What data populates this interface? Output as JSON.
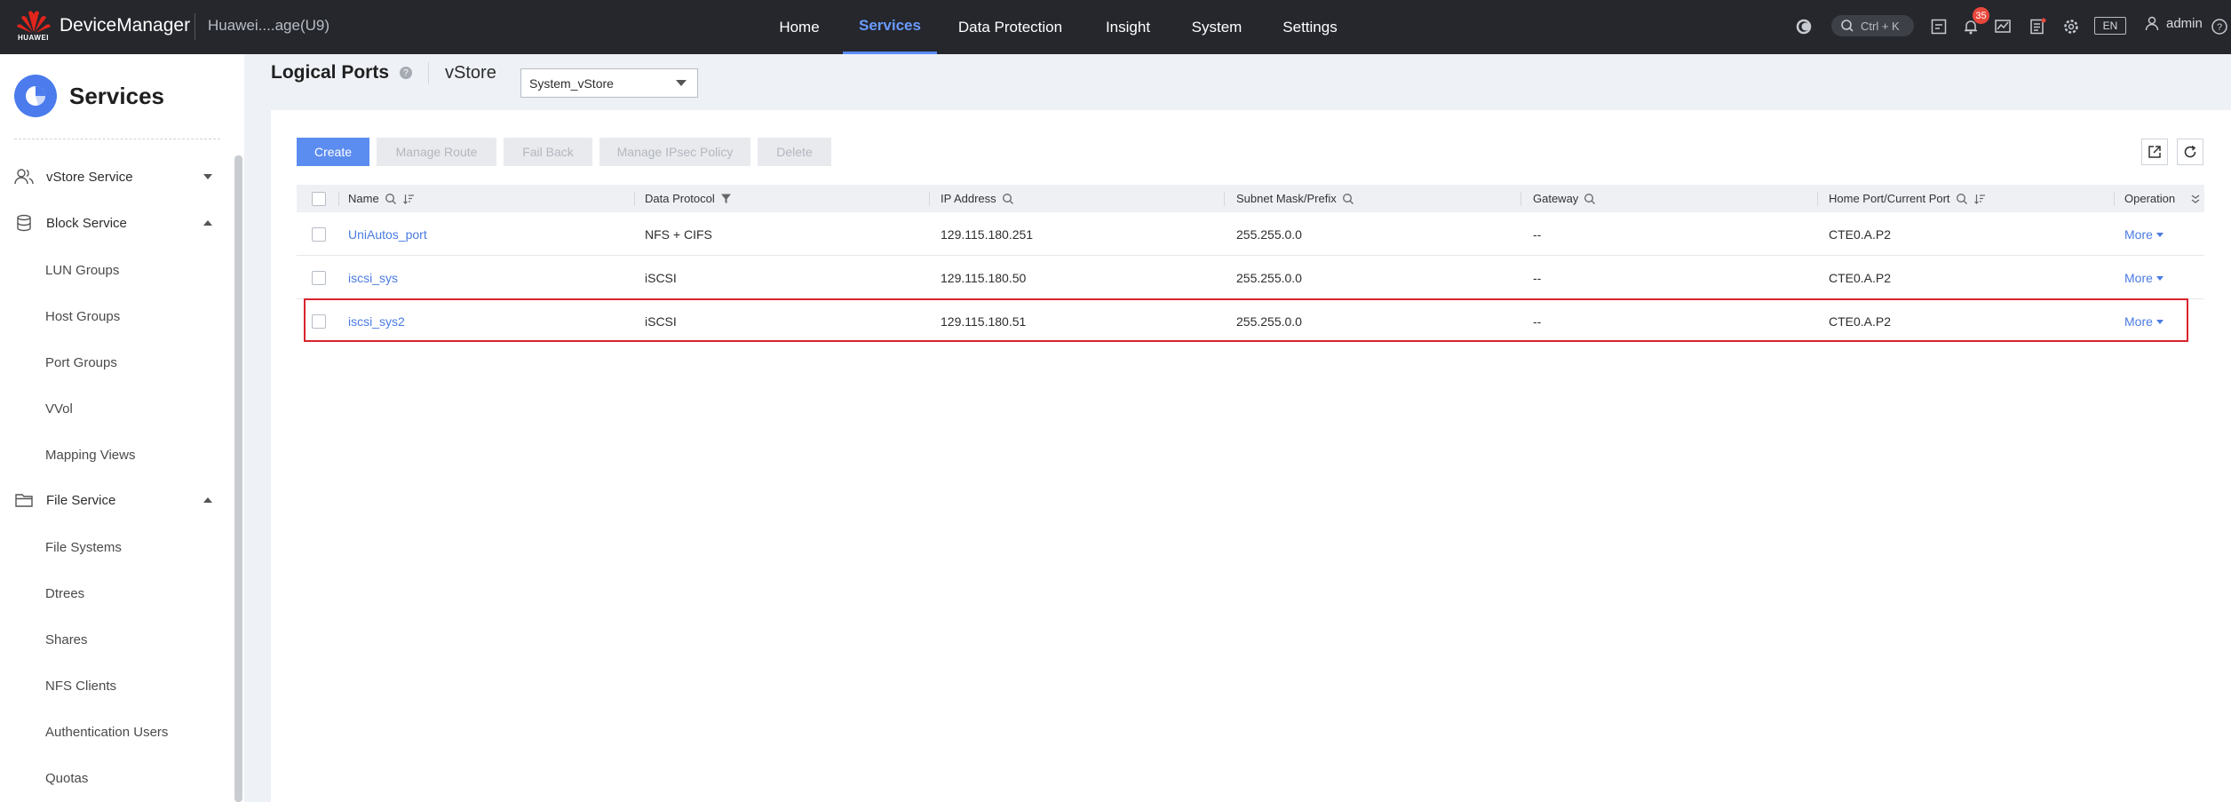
{
  "topbar": {
    "brand": "DeviceManager",
    "logo_text": "HUAWEI",
    "device_name": "Huawei....age(U9)",
    "nav": [
      "Home",
      "Services",
      "Data Protection",
      "Insight",
      "System",
      "Settings"
    ],
    "active_nav": "Services",
    "search_shortcut": "Ctrl + K",
    "alarm_count": "35",
    "language": "EN",
    "user": "admin"
  },
  "sidebar": {
    "title": "Services",
    "groups": {
      "vstore": "vStore Service",
      "block": "Block Service",
      "file": "File Service"
    },
    "block_items": [
      "LUN Groups",
      "Host Groups",
      "Port Groups",
      "VVol",
      "Mapping Views"
    ],
    "file_items": [
      "File Systems",
      "Dtrees",
      "Shares",
      "NFS Clients",
      "Authentication Users",
      "Quotas"
    ]
  },
  "page": {
    "title": "Logical Ports",
    "vstore_label": "vStore",
    "vstore_value": "System_vStore"
  },
  "toolbar": {
    "create": "Create",
    "manage_route": "Manage Route",
    "fail_back": "Fail Back",
    "manage_ipsec": "Manage IPsec Policy",
    "delete": "Delete"
  },
  "table": {
    "columns": [
      "Name",
      "Data Protocol",
      "IP Address",
      "Subnet Mask/Prefix",
      "Gateway",
      "Home Port/Current Port",
      "Operation"
    ],
    "rows": [
      {
        "name": "UniAutos_port",
        "protocol": "NFS + CIFS",
        "ip": "129.115.180.251",
        "mask": "255.255.0.0",
        "gateway": "--",
        "port": "CTE0.A.P2",
        "op": "More"
      },
      {
        "name": "iscsi_sys",
        "protocol": "iSCSI",
        "ip": "129.115.180.50",
        "mask": "255.255.0.0",
        "gateway": "--",
        "port": "CTE0.A.P2",
        "op": "More"
      },
      {
        "name": "iscsi_sys2",
        "protocol": "iSCSI",
        "ip": "129.115.180.51",
        "mask": "255.255.0.0",
        "gateway": "--",
        "port": "CTE0.A.P2",
        "op": "More"
      }
    ]
  },
  "colors": {
    "topbar_bg": "#25272d",
    "accent": "#5b8cf0",
    "link": "#4a7be3",
    "highlight_border": "#d9232d",
    "badge": "#e7473c"
  }
}
